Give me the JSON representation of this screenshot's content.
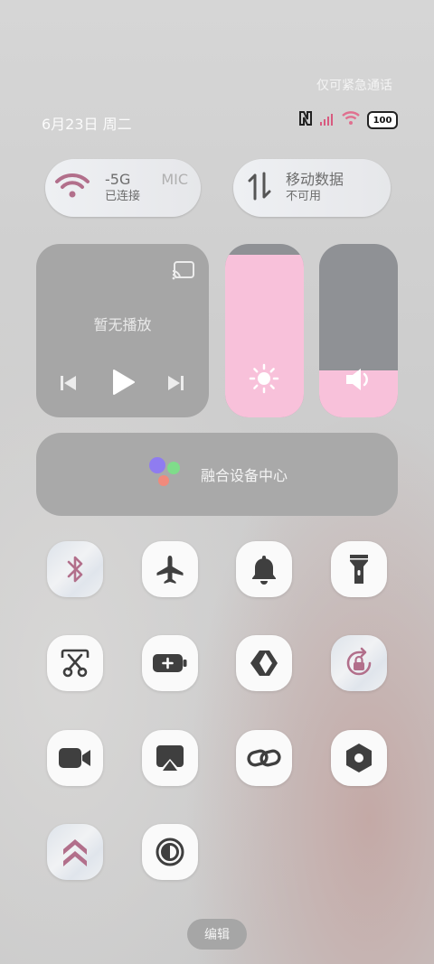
{
  "status_bar": {
    "emergency_text": "仅可紧急通话",
    "date_text": "6月23日 周二",
    "icons": [
      "nfc-icon",
      "signal-icon",
      "wifi-icon",
      "battery-icon"
    ],
    "battery_level": "100"
  },
  "wifi_pill": {
    "title": "-5G",
    "extra": "MIC",
    "status": "已连接",
    "icon": "wifi-icon"
  },
  "data_pill": {
    "title": "移动数据",
    "status": "不可用",
    "icon": "data-transfer-icon"
  },
  "media": {
    "title": "暂无播放",
    "controls": [
      "cast-icon",
      "previous-icon",
      "play-icon",
      "next-icon"
    ]
  },
  "brightness": {
    "level": 0.94,
    "icon": "sun-icon"
  },
  "volume": {
    "level": 0.27,
    "icon": "speaker-icon"
  },
  "device_center": {
    "label": "融合设备中心"
  },
  "tiles": [
    "bluetooth-icon",
    "airplane-icon",
    "bell-icon",
    "flashlight-icon",
    "screenshot-scissors-icon",
    "battery-saver-icon",
    "connect-icon",
    "rotation-lock-icon",
    "video-camera-icon",
    "screen-mirror-icon",
    "link-icon",
    "hexagon-settings-icon",
    "performance-mode-icon",
    "dark-mode-icon"
  ],
  "edit_label": "编辑",
  "colors": {
    "accent_pink": "#f8c1da",
    "icon_dark": "#3f3f3f",
    "icon_pink": "#b26f8b"
  }
}
